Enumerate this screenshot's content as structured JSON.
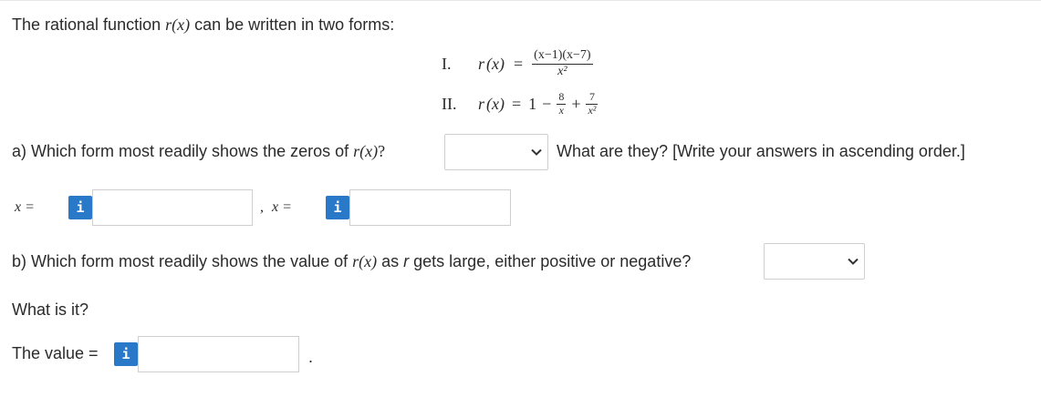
{
  "intro": {
    "text_before": "The rational function ",
    "func": "r",
    "arg": "(x)",
    "text_after": " can be written in two forms:"
  },
  "forms": {
    "form1": {
      "numeral": "I.",
      "lhs_func": "r",
      "lhs_arg": "(x)",
      "equals": "=",
      "numerator": "(x−1)(x−7)",
      "denominator": "x²"
    },
    "form2": {
      "numeral": "II.",
      "lhs_func": "r",
      "lhs_arg": "(x)",
      "equals": "=",
      "one": "1",
      "minus": "−",
      "frac1_num": "8",
      "frac1_den": "x",
      "plus": "+",
      "frac2_num": "7",
      "frac2_den": "x²"
    }
  },
  "part_a": {
    "question_before": "a) Which form most readily shows the zeros of ",
    "func": "r",
    "arg": "(x)",
    "question_mark": "?",
    "select_value": "",
    "followup": "What are they? [Write your answers in ascending order.]",
    "x_label1": "x =",
    "comma": ",",
    "x_label2": "x =",
    "info_icon": "i",
    "input1_value": "",
    "input2_value": ""
  },
  "part_b": {
    "question_before": "b) Which form most readily shows the value of ",
    "func": "r",
    "arg": "(x)",
    "question_middle": " as ",
    "var": "r",
    "question_after": " gets large, either positive or negative?",
    "select_value": "",
    "what_is_it": "What is it?",
    "value_label": "The value =",
    "info_icon": "i",
    "input_value": "",
    "period": "."
  },
  "icons": {
    "dropdown": "chevron-down-icon",
    "info": "info-icon"
  },
  "colors": {
    "info_button": "#2979c8",
    "text": "#2b2b2b",
    "border": "#cfcfcf"
  }
}
